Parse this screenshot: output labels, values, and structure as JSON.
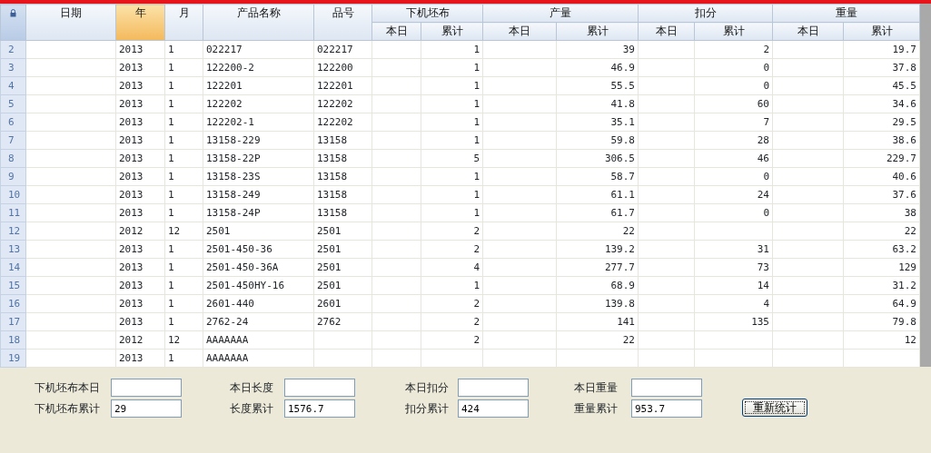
{
  "grid": {
    "columns": [
      {
        "label": "日期",
        "selected": false
      },
      {
        "label": "年",
        "selected": true
      },
      {
        "label": "月",
        "selected": false
      },
      {
        "label": "产品名称",
        "selected": false
      },
      {
        "label": "品号",
        "selected": false
      },
      {
        "label": "下机坯布",
        "selected": false,
        "colspan": 2,
        "sub": [
          "本日",
          "累计"
        ]
      },
      {
        "label": "产量",
        "selected": false,
        "colspan": 2,
        "sub": [
          "本日",
          "累计"
        ]
      },
      {
        "label": "扣分",
        "selected": false,
        "colspan": 2,
        "sub": [
          "本日",
          "累计"
        ]
      },
      {
        "label": "重量",
        "selected": false,
        "colspan": 2,
        "sub": [
          "本日",
          "累计"
        ]
      }
    ],
    "rows": [
      {
        "number": "2",
        "cells": [
          null,
          "2013",
          "1",
          "022217",
          "022217",
          null,
          "1",
          null,
          "39",
          null,
          "2",
          null,
          "19.7"
        ]
      },
      {
        "number": "3",
        "cells": [
          null,
          "2013",
          "1",
          "122200-2",
          "122200",
          null,
          "1",
          null,
          "46.9",
          null,
          "0",
          null,
          "37.8"
        ]
      },
      {
        "number": "4",
        "cells": [
          null,
          "2013",
          "1",
          "122201",
          "122201",
          null,
          "1",
          null,
          "55.5",
          null,
          "0",
          null,
          "45.5"
        ]
      },
      {
        "number": "5",
        "cells": [
          null,
          "2013",
          "1",
          "122202",
          "122202",
          null,
          "1",
          null,
          "41.8",
          null,
          "60",
          null,
          "34.6"
        ]
      },
      {
        "number": "6",
        "cells": [
          null,
          "2013",
          "1",
          "122202-1",
          "122202",
          null,
          "1",
          null,
          "35.1",
          null,
          "7",
          null,
          "29.5"
        ]
      },
      {
        "number": "7",
        "cells": [
          null,
          "2013",
          "1",
          "13158-229",
          "13158",
          null,
          "1",
          null,
          "59.8",
          null,
          "28",
          null,
          "38.6"
        ]
      },
      {
        "number": "8",
        "cells": [
          null,
          "2013",
          "1",
          "13158-22P",
          "13158",
          null,
          "5",
          null,
          "306.5",
          null,
          "46",
          null,
          "229.7"
        ]
      },
      {
        "number": "9",
        "cells": [
          null,
          "2013",
          "1",
          "13158-23S",
          "13158",
          null,
          "1",
          null,
          "58.7",
          null,
          "0",
          null,
          "40.6"
        ]
      },
      {
        "number": "10",
        "cells": [
          null,
          "2013",
          "1",
          "13158-249",
          "13158",
          null,
          "1",
          null,
          "61.1",
          null,
          "24",
          null,
          "37.6"
        ]
      },
      {
        "number": "11",
        "cells": [
          null,
          "2013",
          "1",
          "13158-24P",
          "13158",
          null,
          "1",
          null,
          "61.7",
          null,
          "0",
          null,
          "38"
        ]
      },
      {
        "number": "12",
        "cells": [
          null,
          "2012",
          "12",
          "2501",
          "2501",
          null,
          "2",
          null,
          "22",
          null,
          null,
          null,
          "22"
        ]
      },
      {
        "number": "13",
        "cells": [
          null,
          "2013",
          "1",
          "2501-450-36",
          "2501",
          null,
          "2",
          null,
          "139.2",
          null,
          "31",
          null,
          "63.2"
        ]
      },
      {
        "number": "14",
        "cells": [
          null,
          "2013",
          "1",
          "2501-450-36A",
          "2501",
          null,
          "4",
          null,
          "277.7",
          null,
          "73",
          null,
          "129"
        ]
      },
      {
        "number": "15",
        "cells": [
          null,
          "2013",
          "1",
          "2501-450HY-16",
          "2501",
          null,
          "1",
          null,
          "68.9",
          null,
          "14",
          null,
          "31.2"
        ]
      },
      {
        "number": "16",
        "cells": [
          null,
          "2013",
          "1",
          "2601-440",
          "2601",
          null,
          "2",
          null,
          "139.8",
          null,
          "4",
          null,
          "64.9"
        ]
      },
      {
        "number": "17",
        "cells": [
          null,
          "2013",
          "1",
          "2762-24",
          "2762",
          null,
          "2",
          null,
          "141",
          null,
          "135",
          null,
          "79.8"
        ]
      },
      {
        "number": "18",
        "cells": [
          null,
          "2012",
          "12",
          "AAAAAAA",
          null,
          null,
          "2",
          null,
          "22",
          null,
          null,
          null,
          "12"
        ]
      },
      {
        "number": "19",
        "cells": [
          null,
          "2013",
          "1",
          "AAAAAAA",
          null,
          null,
          null,
          null,
          null,
          null,
          null,
          null,
          null
        ]
      }
    ]
  },
  "summary": {
    "groups": [
      [
        {
          "label": "下机坯布本日"
        },
        {
          "label": "下机坯布累计",
          "value": "29"
        }
      ],
      [
        {
          "label": "本日长度"
        },
        {
          "label": "长度累计",
          "value": "1576.7"
        }
      ],
      [
        {
          "label": "本日扣分"
        },
        {
          "label": "扣分累计",
          "value": "424"
        }
      ],
      [
        {
          "label": "本日重量"
        },
        {
          "label": "重量累计",
          "value": "953.7"
        }
      ]
    ],
    "button": "重新统计"
  }
}
